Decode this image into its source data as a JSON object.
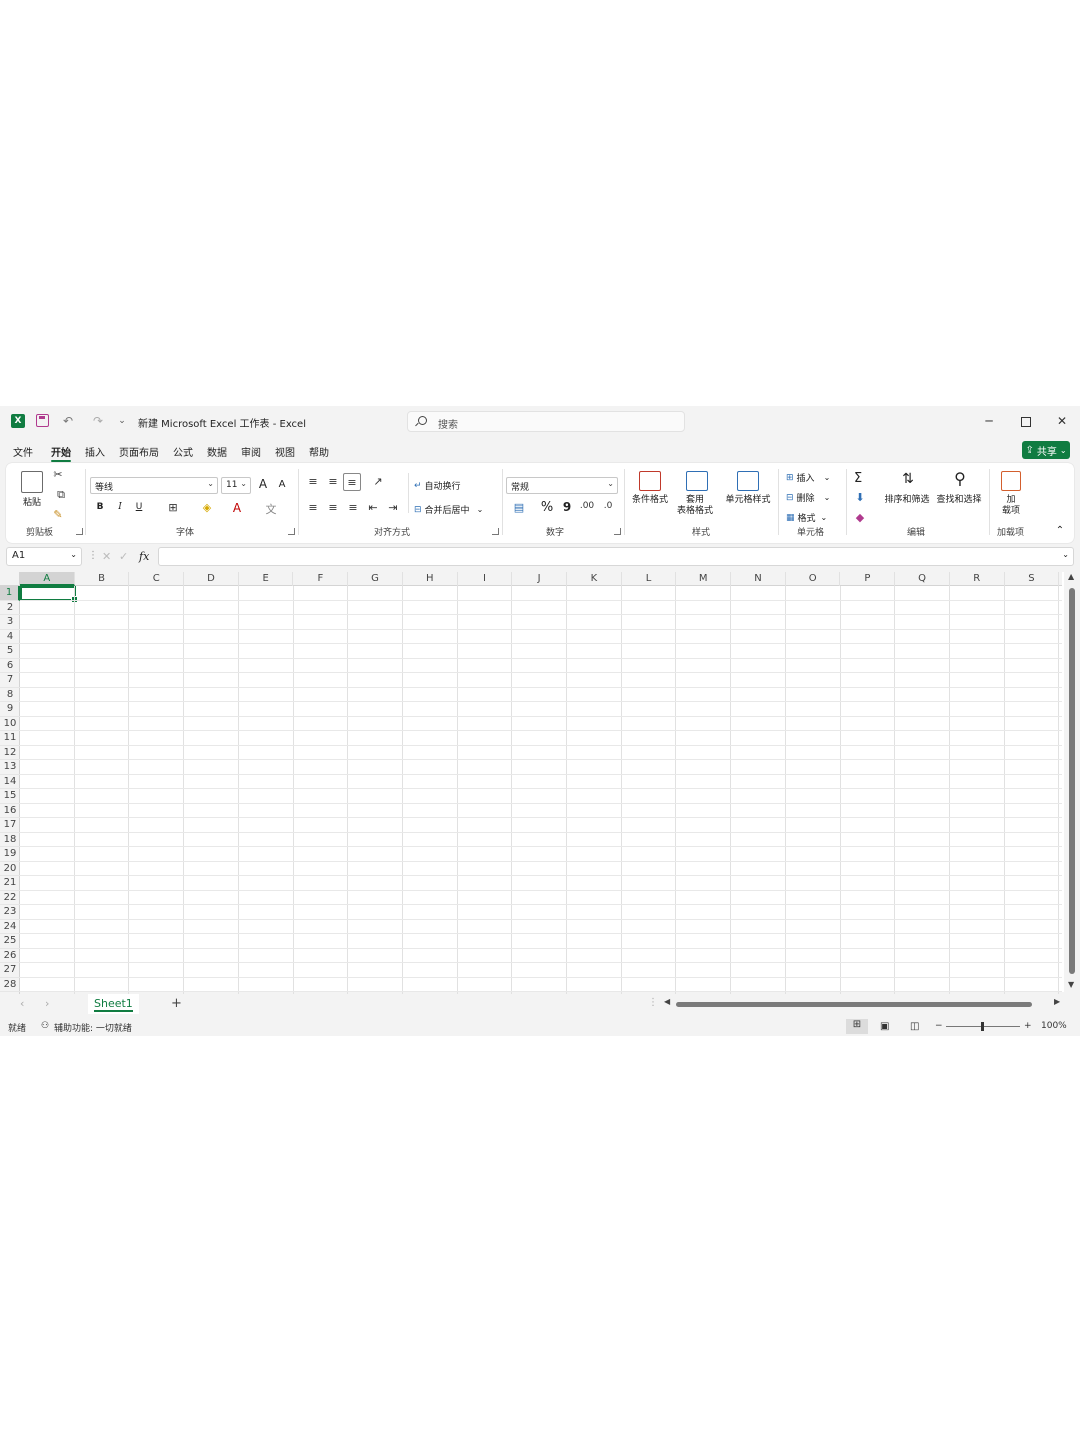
{
  "titlebar": {
    "app_logo": "X",
    "title": "新建 Microsoft Excel 工作表  -  Excel",
    "search_placeholder": "搜索",
    "undo": "↶",
    "redo": "↷",
    "qat_more": "⌄",
    "minimize": "─",
    "close": "✕"
  },
  "tabs": [
    "文件",
    "开始",
    "插入",
    "页面布局",
    "公式",
    "数据",
    "审阅",
    "视图",
    "帮助"
  ],
  "share_label": "共享",
  "ribbon": {
    "groups": {
      "clipboard": "剪贴板",
      "font": "字体",
      "alignment": "对齐方式",
      "number": "数字",
      "styles": "样式",
      "cells": "单元格",
      "editing": "编辑",
      "addins": "加载项"
    },
    "paste": "粘贴",
    "font_name": "等线",
    "font_size": "11",
    "bold": "B",
    "italic": "I",
    "underline": "U",
    "grow_font": "A",
    "shrink_font": "A",
    "wrap_text": "自动换行",
    "merge_center": "合并后居中",
    "number_format": "常规",
    "percent": "%",
    "comma": "9",
    "conditional_format": "条件格式",
    "format_as_table_1": "套用",
    "format_as_table_2": "表格格式",
    "cell_styles": "单元格样式",
    "insert": "插入",
    "delete": "删除",
    "format": "格式",
    "sum": "Σ",
    "sort_filter": "排序和筛选",
    "find_select": "查找和选择",
    "addins_1": "加",
    "addins_2": "载项"
  },
  "formula_bar": {
    "name_box": "A1",
    "fx": "fx"
  },
  "columns": [
    "A",
    "B",
    "C",
    "D",
    "E",
    "F",
    "G",
    "H",
    "I",
    "J",
    "K",
    "L",
    "M",
    "N",
    "O",
    "P",
    "Q",
    "R",
    "S"
  ],
  "rows": [
    "1",
    "2",
    "3",
    "4",
    "5",
    "6",
    "7",
    "8",
    "9",
    "10",
    "11",
    "12",
    "13",
    "14",
    "15",
    "16",
    "17",
    "18",
    "19",
    "20",
    "21",
    "22",
    "23",
    "24",
    "25",
    "26",
    "27",
    "28"
  ],
  "sheet_tab": "Sheet1",
  "add_sheet": "+",
  "status": {
    "ready": "就绪",
    "accessibility": "辅助功能: 一切就绪",
    "zoom": "100%"
  },
  "colors": {
    "accent": "#107c41"
  }
}
